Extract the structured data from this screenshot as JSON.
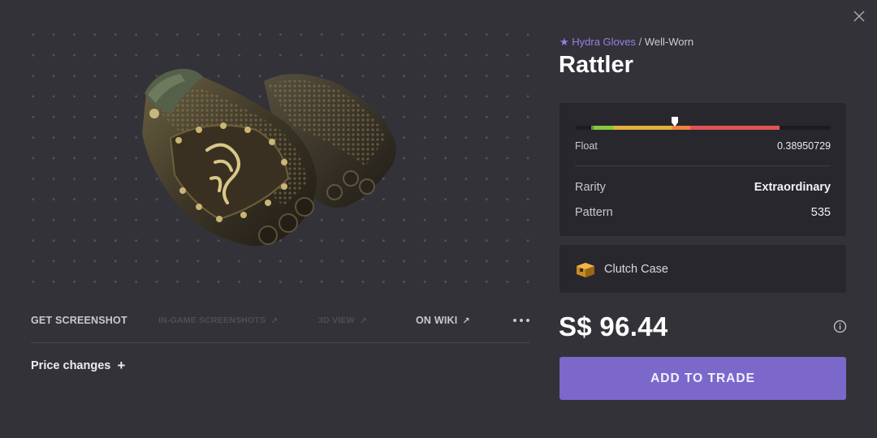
{
  "item": {
    "collection": "★ Hydra Gloves",
    "separator": "/",
    "condition": "Well-Worn",
    "name": "Rattler",
    "image_icon": "gloves-image"
  },
  "actions": {
    "get_screenshot": "GET SCREENSHOT",
    "in_game_screenshots": "IN-GAME SCREENSHOTS",
    "view_3d": "3D VIEW",
    "on_wiki": "ON WIKI",
    "external_arrow": "↗",
    "more_icon": "more-dots-icon"
  },
  "price_changes": {
    "label": "Price changes",
    "toggle": "+"
  },
  "stats": {
    "float_label": "Float",
    "float_value": "0.38950729",
    "float_fraction": 0.3895,
    "float_colors": [
      "#3fa34d",
      "#8dc63f",
      "#e2b33c",
      "#f0823c",
      "#e05555"
    ],
    "rarity_label": "Rarity",
    "rarity_value": "Extraordinary",
    "pattern_label": "Pattern",
    "pattern_value": "535"
  },
  "case": {
    "name": "Clutch Case",
    "icon": "case-icon"
  },
  "price": {
    "value": "S$ 96.44",
    "info_icon": "info-icon"
  },
  "trade_button": {
    "label": "ADD TO TRADE",
    "color": "#7c68cb"
  },
  "close_icon": "close-icon",
  "accent": "#9b7ee6"
}
